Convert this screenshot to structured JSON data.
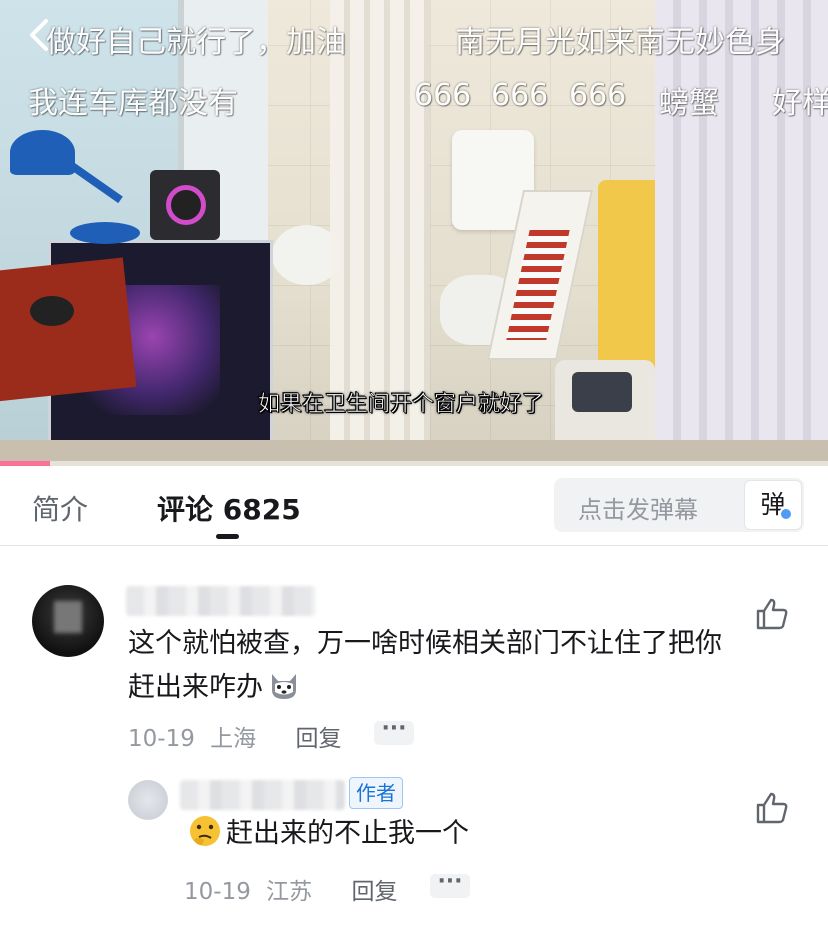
{
  "video": {
    "danmaku": [
      "做好自己就行了，加油",
      "南无月光如来南无妙色身",
      "我连车库都没有",
      "666",
      "666",
      "666",
      "螃蟹",
      "好样"
    ],
    "subtitle": "如果在卫生间开个窗户就好了",
    "progress": 0.06,
    "icons": {
      "back": "back-arrow-icon"
    }
  },
  "tabs": {
    "intro_label": "简介",
    "comments_label": "评论",
    "comments_count": "6825",
    "danmaku_placeholder": "点击发弹幕",
    "danmaku_button_label": "弹"
  },
  "comments": [
    {
      "text": "这个就怕被查，万一啥时候相关部门不让住了把你赶出来咋办",
      "emoji": "dog-emoji",
      "date": "10-19",
      "location": "上海",
      "reply_label": "回复",
      "more_label": "···",
      "replies": [
        {
          "badge": "作者",
          "emoji": "thinking-face-emoji",
          "text": "赶出来的不止我一个",
          "date": "10-19",
          "location": "江苏",
          "reply_label": "回复",
          "more_label": "···"
        }
      ]
    }
  ],
  "colors": {
    "accent": "#fb7299",
    "badge_blue": "#1a73d9",
    "meta_gray": "#9499a0"
  }
}
